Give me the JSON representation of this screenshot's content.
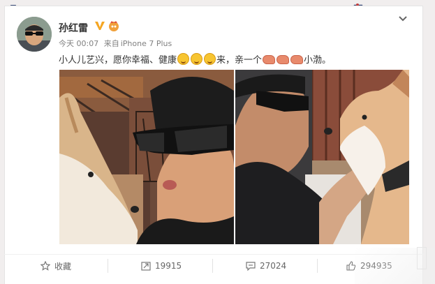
{
  "post": {
    "username": "孙红雷",
    "time": "今天 00:07",
    "source_prefix": "来自",
    "source": "iPhone 7 Plus",
    "text_part1": "小人儿艺兴，愿你幸福、健康",
    "text_part2": "来，亲一个",
    "text_part3": "小渤。"
  },
  "toolbar": {
    "favorite_label": "收藏",
    "repost_count": "19915",
    "comment_count": "27024",
    "like_count": "294935"
  },
  "colors": {
    "accent": "#f5a623",
    "text": "#333333",
    "muted": "#808080",
    "background": "#f1eeee"
  },
  "icons": [
    "bike-icon",
    "v-verified-icon",
    "vip-icon",
    "chevron-down-icon",
    "star-icon",
    "repost-icon",
    "comment-icon",
    "like-icon",
    "grin-emoji-icon",
    "kiss-emoji-icon"
  ]
}
